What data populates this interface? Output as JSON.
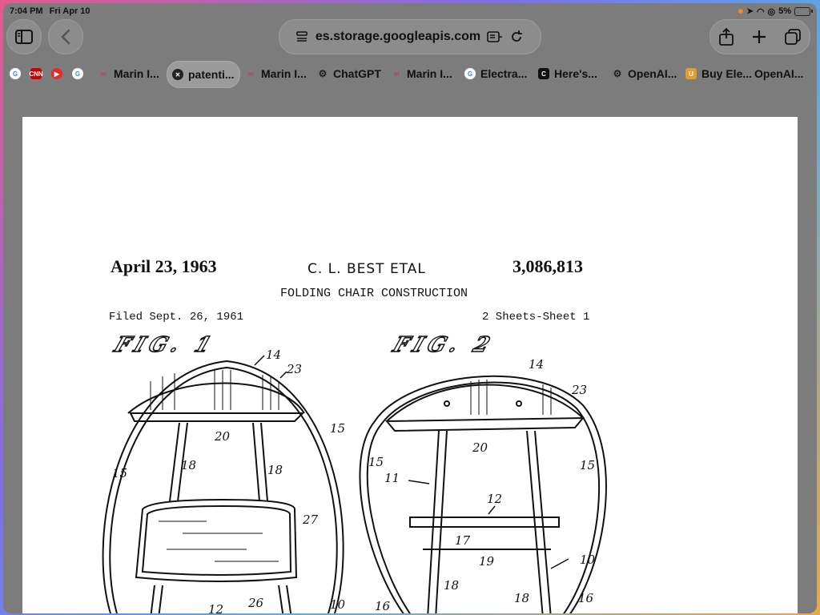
{
  "status": {
    "time": "7:04 PM",
    "date": "Fri Apr 10",
    "battery": "5%"
  },
  "toolbar": {
    "url": "es.storage.googleapis.com"
  },
  "tabs": [
    {
      "label": "Marin I...",
      "icon": "m",
      "color": "#b1455c"
    },
    {
      "label": "patenti...",
      "icon": "close",
      "color": "#222222",
      "active": true
    },
    {
      "label": "Marin I...",
      "icon": "m",
      "color": "#b1455c"
    },
    {
      "label": "ChatGPT",
      "icon": "openai",
      "color": "#222222"
    },
    {
      "label": "Marin I...",
      "icon": "m",
      "color": "#b1455c"
    },
    {
      "label": "Electra...",
      "icon": "google",
      "color": "#4285f4"
    },
    {
      "label": "Here's...",
      "icon": "c",
      "color": "#111111"
    },
    {
      "label": "OpenAI...",
      "icon": "openai",
      "color": "#222222"
    },
    {
      "label": "Buy Ele...",
      "icon": "u",
      "color": "#e0a030"
    },
    {
      "label": "OpenAI...",
      "icon": "none",
      "color": "#222222"
    }
  ],
  "pinned": [
    "google-icon",
    "cnn-icon",
    "youtube-icon",
    "google-icon"
  ],
  "document": {
    "date": "April 23, 1963",
    "inventor": "C. L. BEST ETAL",
    "patent_number": "3,086,813",
    "title": "FOLDING CHAIR CONSTRUCTION",
    "filed": "Filed Sept. 26, 1961",
    "sheets": "2 Sheets-Sheet 1",
    "fig1": "FIG. 1",
    "fig2": "FIG. 2",
    "labels": [
      "14",
      "23",
      "15",
      "20",
      "18",
      "18",
      "15",
      "27",
      "12",
      "26",
      "10",
      "14",
      "23",
      "15",
      "20",
      "15",
      "11",
      "12",
      "17",
      "19",
      "10",
      "18",
      "18",
      "16",
      "16"
    ]
  }
}
